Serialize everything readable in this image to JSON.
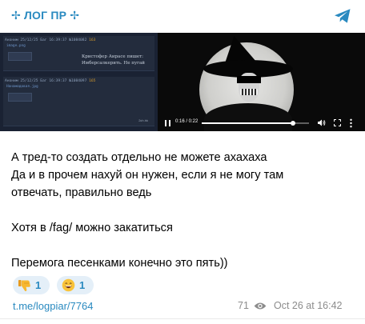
{
  "channel": {
    "name": "✢ ЛОГ ПР ✢",
    "accent_color": "#2a8ac0",
    "share_icon": "telegram-send-icon"
  },
  "media": {
    "screenshot": {
      "posts": [
        {
          "meta_prefix": "Аноним 25/12/25 Баг 16:39:37 №1084082",
          "meta_badge": "163",
          "file": "image.png",
          "quote_line1": "Кристофер Аирасе пишет:",
          "quote_line2": "Имберсалкерить. Не пугай"
        },
        {
          "meta_prefix": "Аноним 25/12/25 Баг 16:39:37 №1084097",
          "meta_badge": "165",
          "file": "Нанамодовая.jpg",
          "quote_line1": "",
          "quote_line2": ""
        }
      ],
      "site": "2ch.hk"
    },
    "video": {
      "time": "0:16 / 0:22",
      "progress_fraction": 0.85
    }
  },
  "message": {
    "lines": [
      "А тред-то создать отдельно не можете ахахаха",
      "Да и в прочем нахуй он нужен, если я не могу там",
      "отвечать, правильно ведь",
      "",
      "Хотя в /fag/ можно закатиться",
      "",
      "Перемога песенками конечно это пять))"
    ]
  },
  "reactions": [
    {
      "emoji": "thumbs-down-icon",
      "count": "1"
    },
    {
      "emoji": "grinning-face-icon",
      "count": "1"
    }
  ],
  "footer": {
    "link": "t.me/logpiar/7764",
    "views": "71",
    "date": "Oct 26 at 16:42"
  }
}
